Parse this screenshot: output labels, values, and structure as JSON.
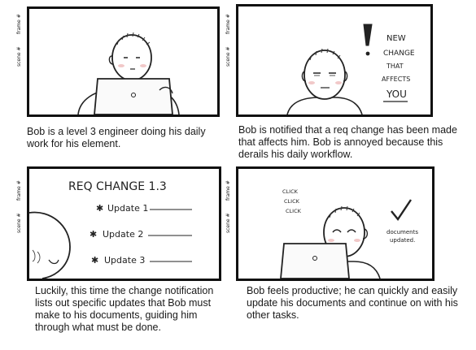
{
  "frame_label": "frame #",
  "scene_label": "scene #",
  "panels": [
    {
      "caption": "Bob is a level 3 engineer doing his daily work for his element."
    },
    {
      "caption": "Bob is notified that a req  change has been made that affects him. Bob is annoyed because this derails his daily workflow.",
      "note_lines": [
        "NEW",
        "CHANGE",
        "THAT",
        "AFFECTS",
        "YOU"
      ]
    },
    {
      "caption": "Luckily, this time the change notification lists out specific updates that Bob must make to his documents, guiding him through what must be done.",
      "title": "REQ CHANGE 1.3",
      "updates": [
        "Update 1",
        "Update 2",
        "Update 3"
      ]
    },
    {
      "caption": "Bob feels productive; he can quickly and easily update his documents and continue on with his other tasks.",
      "clicks": [
        "CLICK",
        "CLICK",
        "CLICK"
      ],
      "note_lines": [
        "documents",
        "updated."
      ]
    }
  ]
}
